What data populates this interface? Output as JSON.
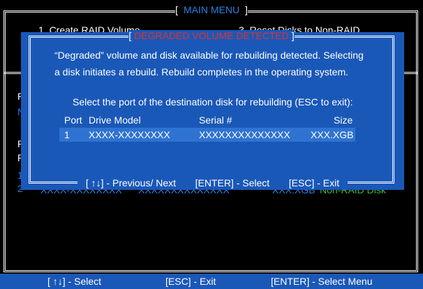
{
  "main_menu": {
    "title": "MAIN MENU",
    "options": [
      "1.    Create  RAID  Volume",
      "3.    Reset Disks to Non-RAID"
    ]
  },
  "background": {
    "side_letters": [
      "R",
      "N",
      "P",
      "P",
      "1",
      "2"
    ],
    "row2_left": "XXXX-XXXXXXXX",
    "row2_serial": "XXXXXXXXXXXXXX",
    "row2_size": "XXX.XGB",
    "row2_type": "Non-RAID  Disk",
    "right_paren": ")"
  },
  "dialog": {
    "title": "DEGRADED VOLUME DETECTED",
    "message_line1": "“Degraded” volume and disk available for rebuilding detected. Selecting",
    "message_line2": "a disk initiates a rebuild. Rebuild completes in the  operating system.",
    "instruction": "Select the port of the destination disk for rebuilding (ESC to exit):",
    "columns": {
      "port": "Port",
      "drive_model": "Drive  Model",
      "serial": "Serial  #",
      "size": "Size"
    },
    "rows": [
      {
        "port": "1",
        "drive_model": "XXXX-XXXXXXXX",
        "serial": "XXXXXXXXXXXXXX",
        "size": "XXX.XGB"
      }
    ],
    "footer": {
      "nav": "[ ↑↓] - Previous/ Next",
      "select": "[ENTER] - Select",
      "exit": "[ESC] - Exit"
    }
  },
  "statusbar": {
    "select": "[ ↑↓] - Select",
    "exit": "[ESC] - Exit",
    "menu": "[ENTER] - Select Menu"
  },
  "colors": {
    "dialog_bg": "#1a58b8",
    "title_red": "#e0322a",
    "menu_blue": "#2a7fe0",
    "green": "#3fb63f"
  }
}
